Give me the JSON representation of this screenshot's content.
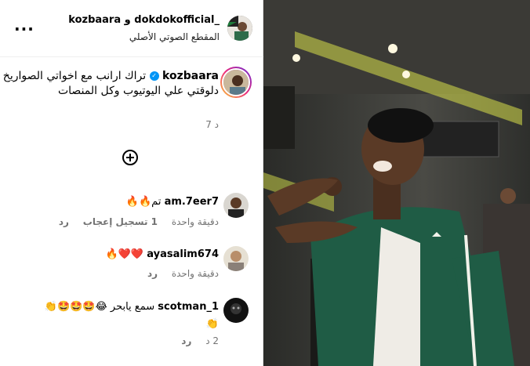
{
  "header": {
    "title": "kozbaara و dokdokofficial_",
    "subtitle": "المقطع الصوتي الأصلي",
    "more_label": "..."
  },
  "caption": {
    "username": "kozbaara",
    "text": "تراك ارانب مع اخواتي الصواريخ دلوقتي علي اليوتيوب وكل المنصات",
    "time": "7 د"
  },
  "comments": [
    {
      "username": "am.7eer7",
      "text": "تم🔥🔥",
      "time": "دقيقة واحدة",
      "likes": "1 تسجيل إعجاب",
      "reply": "رد"
    },
    {
      "username": "ayasalim674",
      "text": "❤️❤️🔥",
      "time": "دقيقة واحدة",
      "reply": "رد"
    },
    {
      "username": "scotman_1",
      "text": "سمع يابحر 😂🤩🤩🤩👏",
      "text2": "👏",
      "time": "2 د",
      "reply": "رد"
    }
  ],
  "colors": {
    "verified": "#0095f6",
    "muted": "#737373",
    "divider": "#dbdbdb"
  }
}
